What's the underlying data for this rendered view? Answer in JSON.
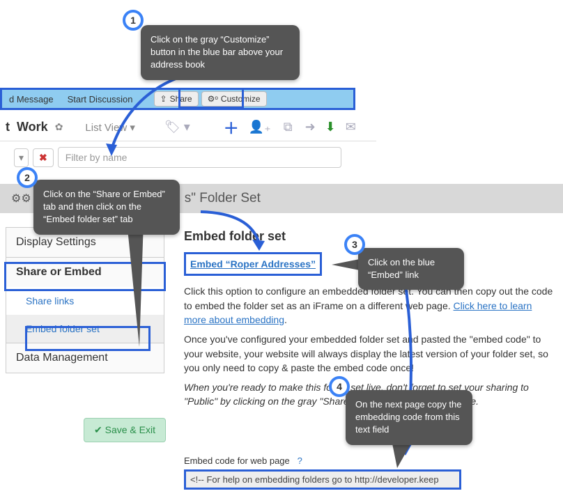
{
  "callouts": {
    "one": {
      "num": "1",
      "text": "Click on the gray “Customize” button in the blue bar above your address book"
    },
    "two": {
      "num": "2",
      "text": "Click on the “Share or Embed” tab and then click on the “Embed folder set” tab"
    },
    "three": {
      "num": "3",
      "text": "Click on the blue “Embed” link"
    },
    "four": {
      "num": "4",
      "text": "On the next page copy the embedding code from this text field"
    }
  },
  "bluebar": {
    "msg": "d Message",
    "discuss": "Start Discussion",
    "share": "Share",
    "customize": "Customize"
  },
  "toolbar": {
    "prefix": "t",
    "title": "Work",
    "view": "List View",
    "filter_placeholder": "Filter by name"
  },
  "grayhead": {
    "title_suffix": "s\" Folder Set"
  },
  "tabs": {
    "display": "Display Settings",
    "share": "Share or Embed",
    "sharelinks": "Share links",
    "embedfolder": "Embed folder set",
    "data": "Data Management"
  },
  "content": {
    "heading": "Embed folder set",
    "embed_link": "Embed “Roper Addresses”",
    "p1a": "Click this option to configure an embedded folder set. You can then copy out the code to embed the folder set as an iFrame on a different web page. ",
    "p1b": "Click here to learn more about embedding",
    "p1c": ".",
    "p2": "Once you've configured your embedded folder set and pasted the \"embed code\" to your website, your website will always display the latest version of your folder set, so you only need to copy & paste the embed code once!",
    "p3": "When you're ready to make this folder set live, don't forget to set your sharing to \"Public\" by clicking on the gray \"Share\" button in the blue bar above."
  },
  "save_exit": "Save & Exit",
  "embed_code": {
    "label": "Embed code for web page",
    "q": "?",
    "value": "<!-- For help on embedding folders go to http://developer.keep"
  }
}
